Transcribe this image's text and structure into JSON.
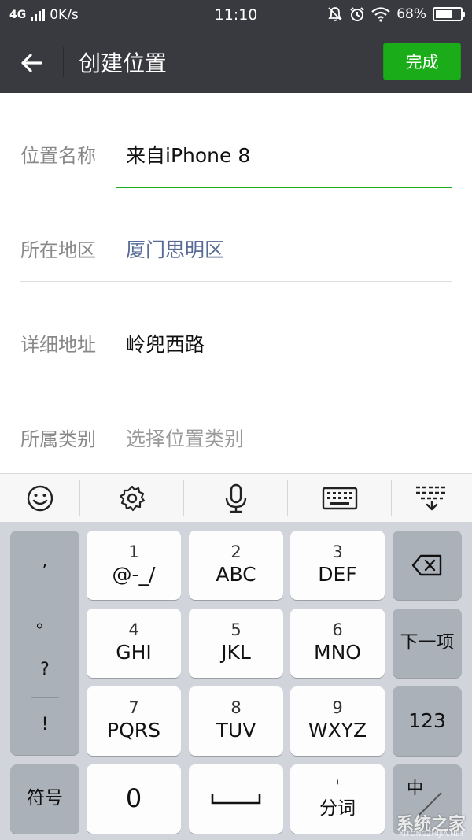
{
  "status_bar": {
    "network": "4G",
    "speed": "0K/s",
    "time": "11:10",
    "battery": "68%",
    "battery_level": 0.68
  },
  "header": {
    "title": "创建位置",
    "done_label": "完成"
  },
  "form": {
    "name": {
      "label": "位置名称",
      "value": "来自iPhone 8"
    },
    "region": {
      "label": "所在地区",
      "value": "厦门思明区"
    },
    "address": {
      "label": "详细地址",
      "value": "岭兜西路"
    },
    "category": {
      "label": "所属类别",
      "placeholder": "选择位置类别"
    }
  },
  "keyboard": {
    "punctuation": [
      ",",
      "。",
      "?",
      "!"
    ],
    "keys": [
      {
        "num": "1",
        "letters": "@-_/"
      },
      {
        "num": "2",
        "letters": "ABC"
      },
      {
        "num": "3",
        "letters": "DEF"
      },
      {
        "num": "4",
        "letters": "GHI"
      },
      {
        "num": "5",
        "letters": "JKL"
      },
      {
        "num": "6",
        "letters": "MNO"
      },
      {
        "num": "7",
        "letters": "PQRS"
      },
      {
        "num": "8",
        "letters": "TUV"
      },
      {
        "num": "9",
        "letters": "WXYZ"
      }
    ],
    "next_label": "下一项",
    "num_label": "123",
    "symbol_label": "符号",
    "zero_label": "0",
    "split_top": "'",
    "split_label": "分词",
    "lang_label": "中"
  },
  "watermark": {
    "text": "系统之家",
    "sub": "XITONGZHIJIA.NET"
  },
  "colors": {
    "header_bg": "#393a3f",
    "accent_green": "#1aad19",
    "link_blue": "#576b95"
  }
}
